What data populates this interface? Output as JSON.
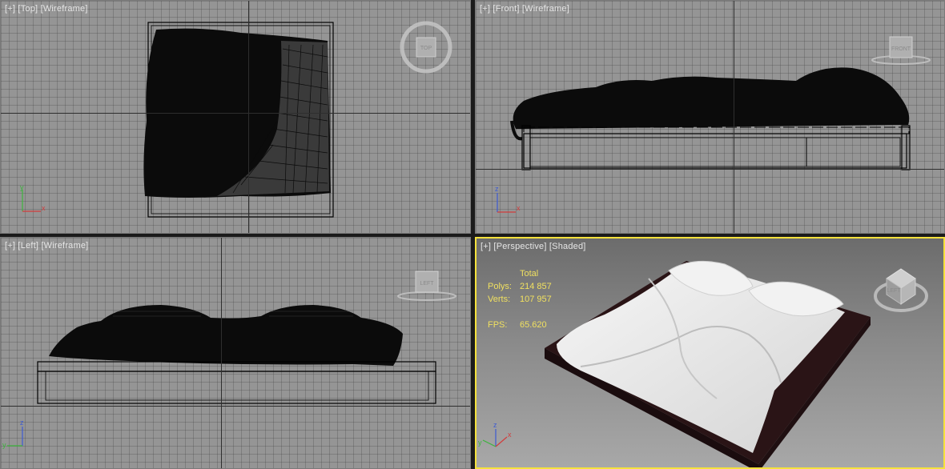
{
  "viewports": {
    "top": {
      "label": {
        "plus": "+",
        "view": "Top",
        "mode": "Wireframe"
      },
      "navcube": "TOP",
      "gizmo": {
        "a": "y",
        "b": "x"
      }
    },
    "front": {
      "label": {
        "plus": "+",
        "view": "Front",
        "mode": "Wireframe"
      },
      "navcube": "FRONT",
      "gizmo": {
        "a": "z",
        "b": "x"
      }
    },
    "left": {
      "label": {
        "plus": "+",
        "view": "Left",
        "mode": "Wireframe"
      },
      "navcube": "LEFT",
      "gizmo": {
        "a": "z",
        "b": "y"
      }
    },
    "perspective": {
      "label": {
        "plus": "+",
        "view": "Perspective",
        "mode": "Shaded"
      },
      "navcube": "LEFT",
      "active_border_color": "#f5e23c",
      "gizmo": {
        "a": "z",
        "b": "x",
        "c": "y"
      },
      "stats": {
        "header": "Total",
        "polys_label": "Polys:",
        "polys_value": "214 857",
        "verts_label": "Verts:",
        "verts_value": "107 957",
        "fps_label": "FPS:",
        "fps_value": "65.620"
      }
    }
  },
  "colors": {
    "viewport_bg": "#959595",
    "stats_text": "#f0e060",
    "axis_x": "#d23c3c",
    "axis_y": "#3cb43c",
    "axis_z": "#3c5ad2"
  }
}
